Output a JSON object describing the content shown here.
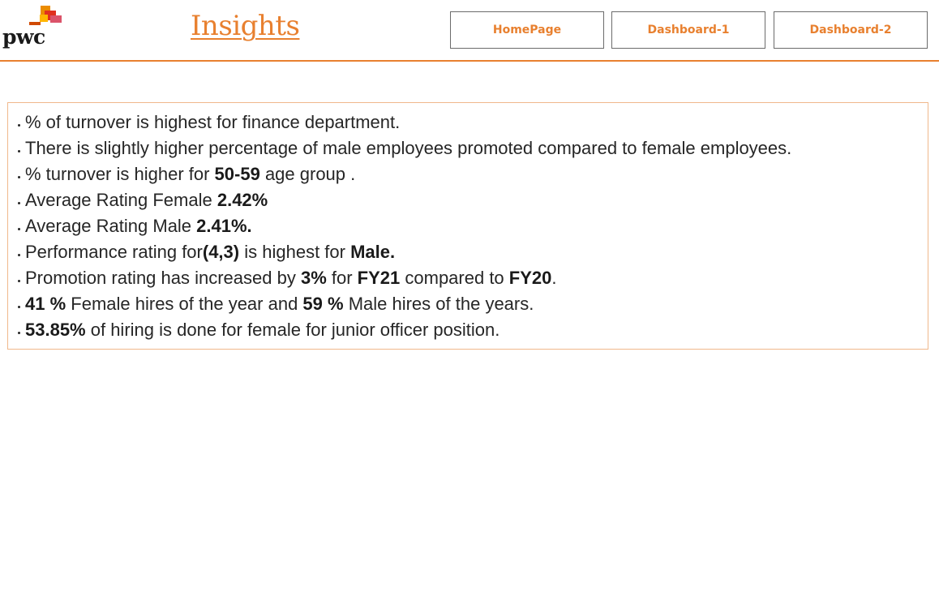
{
  "header": {
    "logo_text": "pwc",
    "title": "Insights",
    "nav": [
      {
        "label": "HomePage"
      },
      {
        "label": "Dashboard-1"
      },
      {
        "label": "Dashboard-2"
      }
    ]
  },
  "insights": [
    {
      "t1": "% of turnover is highest for finance department."
    },
    {
      "t1": "There is slightly higher percentage of male employees promoted compared to female employees."
    },
    {
      "t1": "% turnover is higher for ",
      "b1": "50-59",
      "t2": " age group ."
    },
    {
      "t1": "Average Rating Female ",
      "b1": "2.42%"
    },
    {
      "t1": "Average Rating Male ",
      "b1": "2.41%."
    },
    {
      "t1": "Performance rating for",
      "b1": "(4,3)",
      "t2": " is highest for ",
      "b2": "Male."
    },
    {
      "t1": "Promotion rating has increased by ",
      "b1": "3%",
      "t2": " for ",
      "b2": "FY21",
      "t3": " compared to ",
      "b3": "FY20",
      "t4": "."
    },
    {
      "b1": "41 %",
      "t1": " Female hires of the year and ",
      "b2": "59 %",
      "t2": " Male hires of the years."
    },
    {
      "b1": "53.85%",
      "t1": " of hiring is done for female for junior officer position."
    }
  ],
  "colors": {
    "accent": "#e8802f",
    "box_border": "#f0b88c",
    "text": "#262626"
  }
}
